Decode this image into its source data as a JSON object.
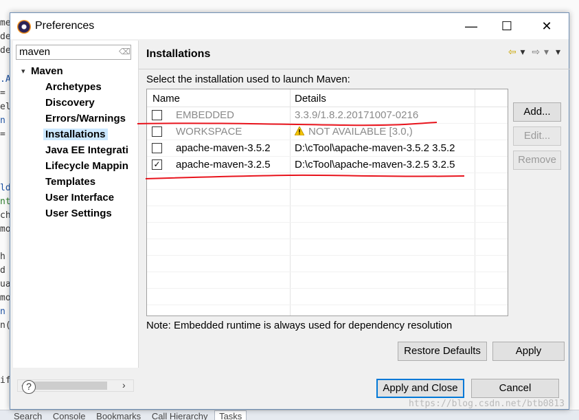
{
  "background": {
    "code_fragments": [
      "me",
      "de",
      "de",
      ".A",
      "=",
      "el",
      "n",
      "=",
      "ld",
      "nt",
      "ch",
      "mo",
      "h",
      "d",
      "ua",
      "mo",
      "n",
      "n(",
      "if"
    ],
    "bottom_tabs": [
      "Search",
      "Console",
      "Bookmarks",
      "Call Hierarchy",
      "Tasks"
    ]
  },
  "window": {
    "title": "Preferences",
    "minimize_glyph": "—",
    "maximize_glyph": "☐",
    "close_glyph": "✕"
  },
  "filter": {
    "value": "maven",
    "clear_glyph": "⌫"
  },
  "tree": {
    "root": "Maven",
    "items": [
      "Archetypes",
      "Discovery",
      "Errors/Warnings",
      "Installations",
      "Java EE Integrati",
      "Lifecycle Mappin",
      "Templates",
      "User Interface",
      "User Settings"
    ],
    "selected": "Installations"
  },
  "page": {
    "title": "Installations",
    "prompt": "Select the installation used to launch Maven:",
    "note": "Note: Embedded runtime is always used for dependency resolution"
  },
  "table": {
    "columns": [
      "Name",
      "Details"
    ],
    "rows": [
      {
        "checked": false,
        "check_glyph": "",
        "name": "EMBEDDED",
        "details": "3.3.9/1.8.2.20171007-0216",
        "warning": false
      },
      {
        "checked": false,
        "check_glyph": "",
        "name": "WORKSPACE",
        "details": "NOT AVAILABLE [3.0,)",
        "warning": true
      },
      {
        "checked": false,
        "check_glyph": "",
        "name": "apache-maven-3.5.2",
        "details": "D:\\cTool\\apache-maven-3.5.2 3.5.2",
        "warning": false
      },
      {
        "checked": true,
        "check_glyph": "✓",
        "name": "apache-maven-3.2.5",
        "details": "D:\\cTool\\apache-maven-3.2.5 3.2.5",
        "warning": false
      }
    ]
  },
  "side_buttons": {
    "add": "Add...",
    "edit": "Edit...",
    "remove": "Remove"
  },
  "buttons": {
    "restore_defaults": "Restore Defaults",
    "apply": "Apply",
    "apply_and_close": "Apply and Close",
    "cancel": "Cancel"
  },
  "nav_glyphs": {
    "back": "⇦",
    "forward": "⇨",
    "menu": "▾"
  },
  "watermark": "https://blog.csdn.net/btb0813",
  "colors": {
    "selection": "#cce8ff",
    "default_button_border": "#0078d7",
    "annotation": "#e8121b"
  }
}
